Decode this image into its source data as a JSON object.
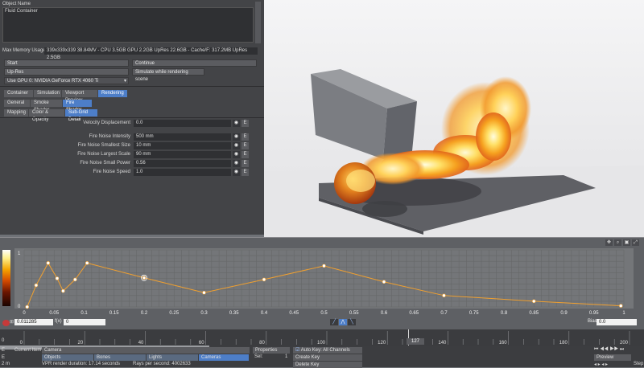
{
  "panel": {
    "object_name_label": "Object Name",
    "object_name_value": "Fluid Container",
    "memory_label": "Max Memory Usage",
    "memory_value": "339x339x339 38.84MV - CPU 3.5GB GPU 2.2GB UpRes 22.6GB - Cache/F: 317.2MB UpRes 2.5GB",
    "start_button": "Start",
    "continue_button": "Continue",
    "upres_button": "Up-Res",
    "simulate_rendering_button": "Simulate while rendering scene",
    "gpu_select": "Use GPU 0: NVIDIA GeForce RTX 4060 Ti",
    "main_tabs": [
      "Container",
      "Simulation",
      "Viewport Preview",
      "Rendering"
    ],
    "sub_tabs": [
      "General",
      "Smoke Shader",
      "Fire Shader"
    ],
    "sub_sub_tabs": [
      "Mapping",
      "Color & Opacity",
      "Sub-Grid Detail"
    ],
    "velocity_label": "Velocity Displacement",
    "velocity_value": "0.0",
    "fields": [
      {
        "label": "Fire Noise Intensity",
        "value": "500 mm"
      },
      {
        "label": "Fire Noise Smallest Size",
        "value": "10 mm"
      },
      {
        "label": "Fire Noise Largest Scale",
        "value": "90 mm"
      },
      {
        "label": "Fire Noise Small Power",
        "value": "0.56"
      },
      {
        "label": "Fire Noise Speed",
        "value": "1.0"
      }
    ],
    "e_label": "E"
  },
  "graph": {
    "y_label_top": "1",
    "y_label_bottom": "0",
    "x_ticks": [
      "0",
      "0.05",
      "0.1",
      "0.15",
      "0.2",
      "0.25",
      "0.3",
      "0.35",
      "0.4",
      "0.45",
      "0.5",
      "0.55",
      "0.6",
      "0.65",
      "0.7",
      "0.75",
      "0.8",
      "0.85",
      "0.9",
      "0.95",
      "1"
    ],
    "points": [
      [
        0.005,
        0.0
      ],
      [
        0.02,
        0.38
      ],
      [
        0.04,
        0.77
      ],
      [
        0.055,
        0.5
      ],
      [
        0.065,
        0.28
      ],
      [
        0.085,
        0.48
      ],
      [
        0.105,
        0.77
      ],
      [
        0.2,
        0.51
      ],
      [
        0.3,
        0.25
      ],
      [
        0.4,
        0.48
      ],
      [
        0.5,
        0.72
      ],
      [
        0.6,
        0.44
      ],
      [
        0.7,
        0.2
      ],
      [
        0.85,
        0.1
      ],
      [
        0.995,
        0.02
      ]
    ],
    "selected_point_index": 7,
    "x_field": "0.011285",
    "fx_label": "f(x)",
    "fx_field": "0",
    "bias_label": "Bias",
    "bias_field": "0.0"
  },
  "timeline": {
    "ticks": [
      "0",
      "20",
      "40",
      "60",
      "80",
      "100",
      "120",
      "140",
      "160",
      "180",
      "200"
    ],
    "frame_marker": "127",
    "frame_120": "120",
    "current_item_label": "Current Item",
    "current_item_value": "Camera",
    "properties_button": "Properties",
    "sel_label": "Sel:",
    "sel_value": "1",
    "auto_key_label": "Auto Key: All Channels",
    "create_key_button": "Create Key",
    "delete_key_button": "Delete Key",
    "preview_dropdown": "Preview",
    "step_label": "Step",
    "objects_tab": "Objects",
    "bones_tab": "Bones",
    "lights_tab": "Lights",
    "cameras_tab": "Cameras",
    "left_value": "2 m",
    "render_duration": "VPR render duration: 17.14 seconds",
    "rays_per_second": "Rays per second: 4002633",
    "start_frame": "0"
  }
}
